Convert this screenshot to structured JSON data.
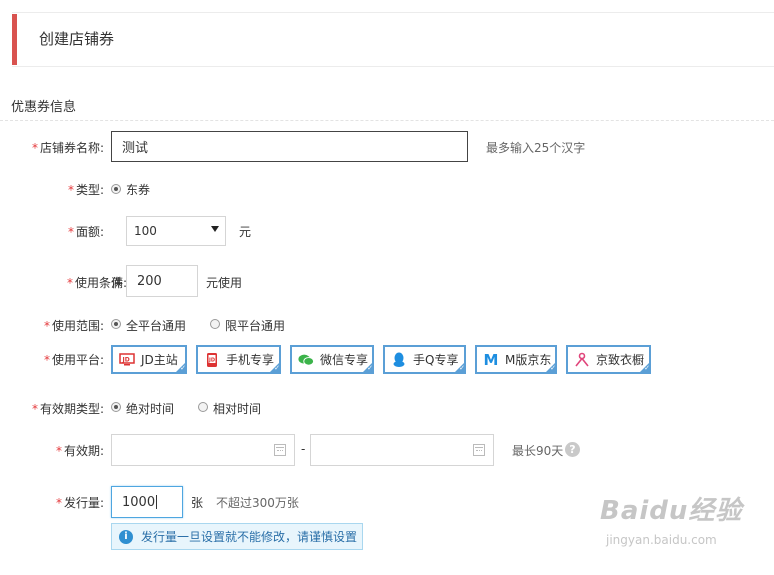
{
  "header": {
    "title": "创建店铺券"
  },
  "section": {
    "title": "优惠券信息"
  },
  "form": {
    "required_mark": "*",
    "name": {
      "label": "店铺券名称:",
      "value": "测试",
      "hint": "最多输入25个汉字"
    },
    "type": {
      "label": "类型:",
      "option": "东券"
    },
    "amount": {
      "label": "面额:",
      "selected": "100",
      "unit": "元"
    },
    "condition": {
      "label": "使用条件:",
      "prefix": "满",
      "value": "200",
      "suffix": "元使用"
    },
    "scope": {
      "label": "使用范围:",
      "options": [
        "全平台通用",
        "限平台通用"
      ]
    },
    "platform": {
      "label": "使用平台:",
      "items": [
        "JD主站",
        "手机专享",
        "微信专享",
        "手Q专享",
        "M版京东",
        "京致衣橱"
      ]
    },
    "validity_type": {
      "label": "有效期类型:",
      "options": [
        "绝对时间",
        "相对时间"
      ]
    },
    "validity": {
      "label": "有效期:",
      "separator": "-",
      "hint": "最长90天",
      "help": "?"
    },
    "quantity": {
      "label": "发行量:",
      "value": "1000",
      "unit": "张",
      "hint": "不超过300万张"
    },
    "notice": {
      "icon": "i",
      "text": "发行量一旦设置就不能修改，请谨慎设置"
    }
  },
  "colors": {
    "accent_bar": "#d9534f",
    "platform_border": "#5b9fd6",
    "required": "#e4393c"
  },
  "icons": [
    "jd-main-icon",
    "mobile-icon",
    "wechat-icon",
    "qq-icon",
    "m-jd-icon",
    "hanger-icon"
  ],
  "watermark": {
    "brand": "Baidu经验",
    "url": "jingyan.baidu.com"
  }
}
